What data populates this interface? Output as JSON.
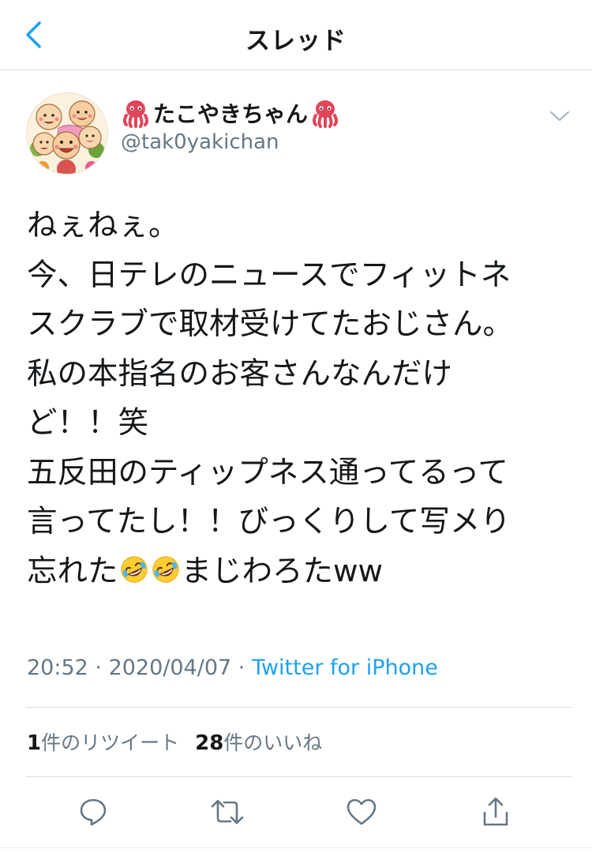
{
  "header": {
    "title": "スレッド"
  },
  "tweet": {
    "display_name": "たこやきちゃん",
    "handle": "@tak0yakichan",
    "text_lines": [
      "ねぇねぇ。",
      "今、日テレのニュースでフィットネ",
      "スクラブで取材受けてたおじさん。",
      "私の本指名のお客さんなんだけ",
      "ど！！笑",
      "五反田のティップネス通ってるって",
      "言ってたし！！びっくりして写メり"
    ],
    "last_line_before": "忘れた",
    "last_line_after": "まじわろたww",
    "time": "20:52",
    "date": "2020/04/07",
    "separator": " · ",
    "source": "Twitter for iPhone",
    "retweet_count": "1",
    "retweet_label": "件のリツイート",
    "like_count": "28",
    "like_label": "件のいいね"
  },
  "icons": {
    "back": "chevron-left-icon",
    "caret": "chevron-down-icon",
    "reply": "speech-bubble-icon",
    "retweet": "retweet-icon",
    "like": "heart-icon",
    "share": "share-icon",
    "name_decoration": "octopus-emoji",
    "laugh": "rolling-on-floor-laughing-emoji"
  },
  "colors": {
    "accent": "#1da1f2",
    "text": "#14171a",
    "secondary": "#657786",
    "divider": "#d6dbdf"
  }
}
